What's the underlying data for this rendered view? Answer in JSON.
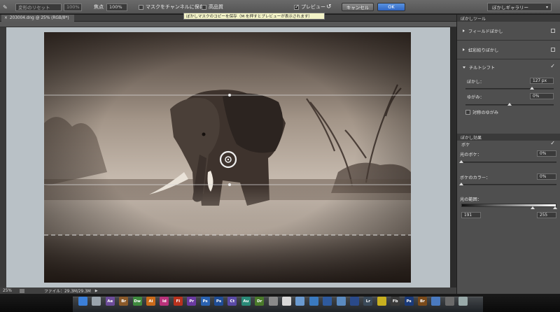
{
  "options_bar": {
    "field_label": "変形のリセット",
    "field_value": "100%",
    "focus_label": "焦点",
    "focus_value": "100%",
    "save_mask_label": "マスクをチャンネルに保存",
    "high_quality_label": "高品質",
    "preview_label": "プレビュー",
    "cancel_label": "キャンセル",
    "ok_label": "OK",
    "gallery_label": "ぼかしギャラリー",
    "tooltip": "ぼかしマスクのコピーを保存（M を押すとプレビューが表示されます）"
  },
  "document": {
    "tab_label": "203004.dng @ 25% (RGB/8*)"
  },
  "status_bar": {
    "zoom": "25%",
    "file_info": "ファイル：29.3M/29.3M"
  },
  "panel": {
    "blur_tools_header": "ぼかしツール",
    "field_blur_label": "フィールドぼかし",
    "iris_blur_label": "虹彩絞りぼかし",
    "tilt_shift_label": "チルトシフト",
    "blur_label": "ぼかし：",
    "blur_value": "127 px",
    "blur_level": 0.75,
    "distortion_label": "ゆがみ：",
    "distortion_value": "0%",
    "distortion_level": 0.5,
    "symmetric_label": "対称のゆがみ",
    "effects_header": "ぼかし効果",
    "bokeh_label": "ボケ",
    "light_bokeh_label": "光のボケ：",
    "light_bokeh_value": "0%",
    "light_bokeh_level": 0.0,
    "bokeh_color_label": "ボケのカラー：",
    "bokeh_color_value": "0%",
    "bokeh_color_level": 0.0,
    "light_range_label": "光の範囲：",
    "light_range_low": "191",
    "light_range_high": "255",
    "light_range_low_level": 0.75,
    "light_range_high_level": 1.0
  },
  "dock": {
    "icons": [
      {
        "label": "",
        "color": "#3b7fd8"
      },
      {
        "label": "",
        "color": "#9aa4ad"
      },
      {
        "label": "Ae",
        "color": "#6c4c9a"
      },
      {
        "label": "Br",
        "color": "#8a5a2a"
      },
      {
        "label": "Dw",
        "color": "#3e8a3e"
      },
      {
        "label": "Ai",
        "color": "#c96a1a"
      },
      {
        "label": "Id",
        "color": "#b8327a"
      },
      {
        "label": "Fl",
        "color": "#b8321e"
      },
      {
        "label": "Pr",
        "color": "#6a3aa0"
      },
      {
        "label": "Ps",
        "color": "#2a62b0"
      },
      {
        "label": "Ps",
        "color": "#1f4d96"
      },
      {
        "label": "Ct",
        "color": "#5a4aa6"
      },
      {
        "label": "Au",
        "color": "#2a8a78"
      },
      {
        "label": "Dr",
        "color": "#4a7a2a"
      },
      {
        "label": "",
        "color": "#8a8a8a"
      },
      {
        "label": "",
        "color": "#d8d8d8"
      },
      {
        "label": "",
        "color": "#6a9ad0"
      },
      {
        "label": "",
        "color": "#3a7ac0"
      },
      {
        "label": "",
        "color": "#2e5a9e"
      },
      {
        "label": "",
        "color": "#5a8ac0"
      },
      {
        "label": "",
        "color": "#2a4a8a"
      },
      {
        "label": "Lr",
        "color": "#3a4a5a"
      },
      {
        "label": "",
        "color": "#c8b020"
      },
      {
        "label": "Fb",
        "color": "#3a3a3a"
      },
      {
        "label": "Ps",
        "color": "#1a3a7a"
      },
      {
        "label": "Br",
        "color": "#7a4a1a"
      },
      {
        "label": "",
        "color": "#4a7ac0"
      },
      {
        "label": "",
        "color": "#6a6a6a"
      },
      {
        "label": "",
        "color": "#9aa"
      }
    ]
  }
}
